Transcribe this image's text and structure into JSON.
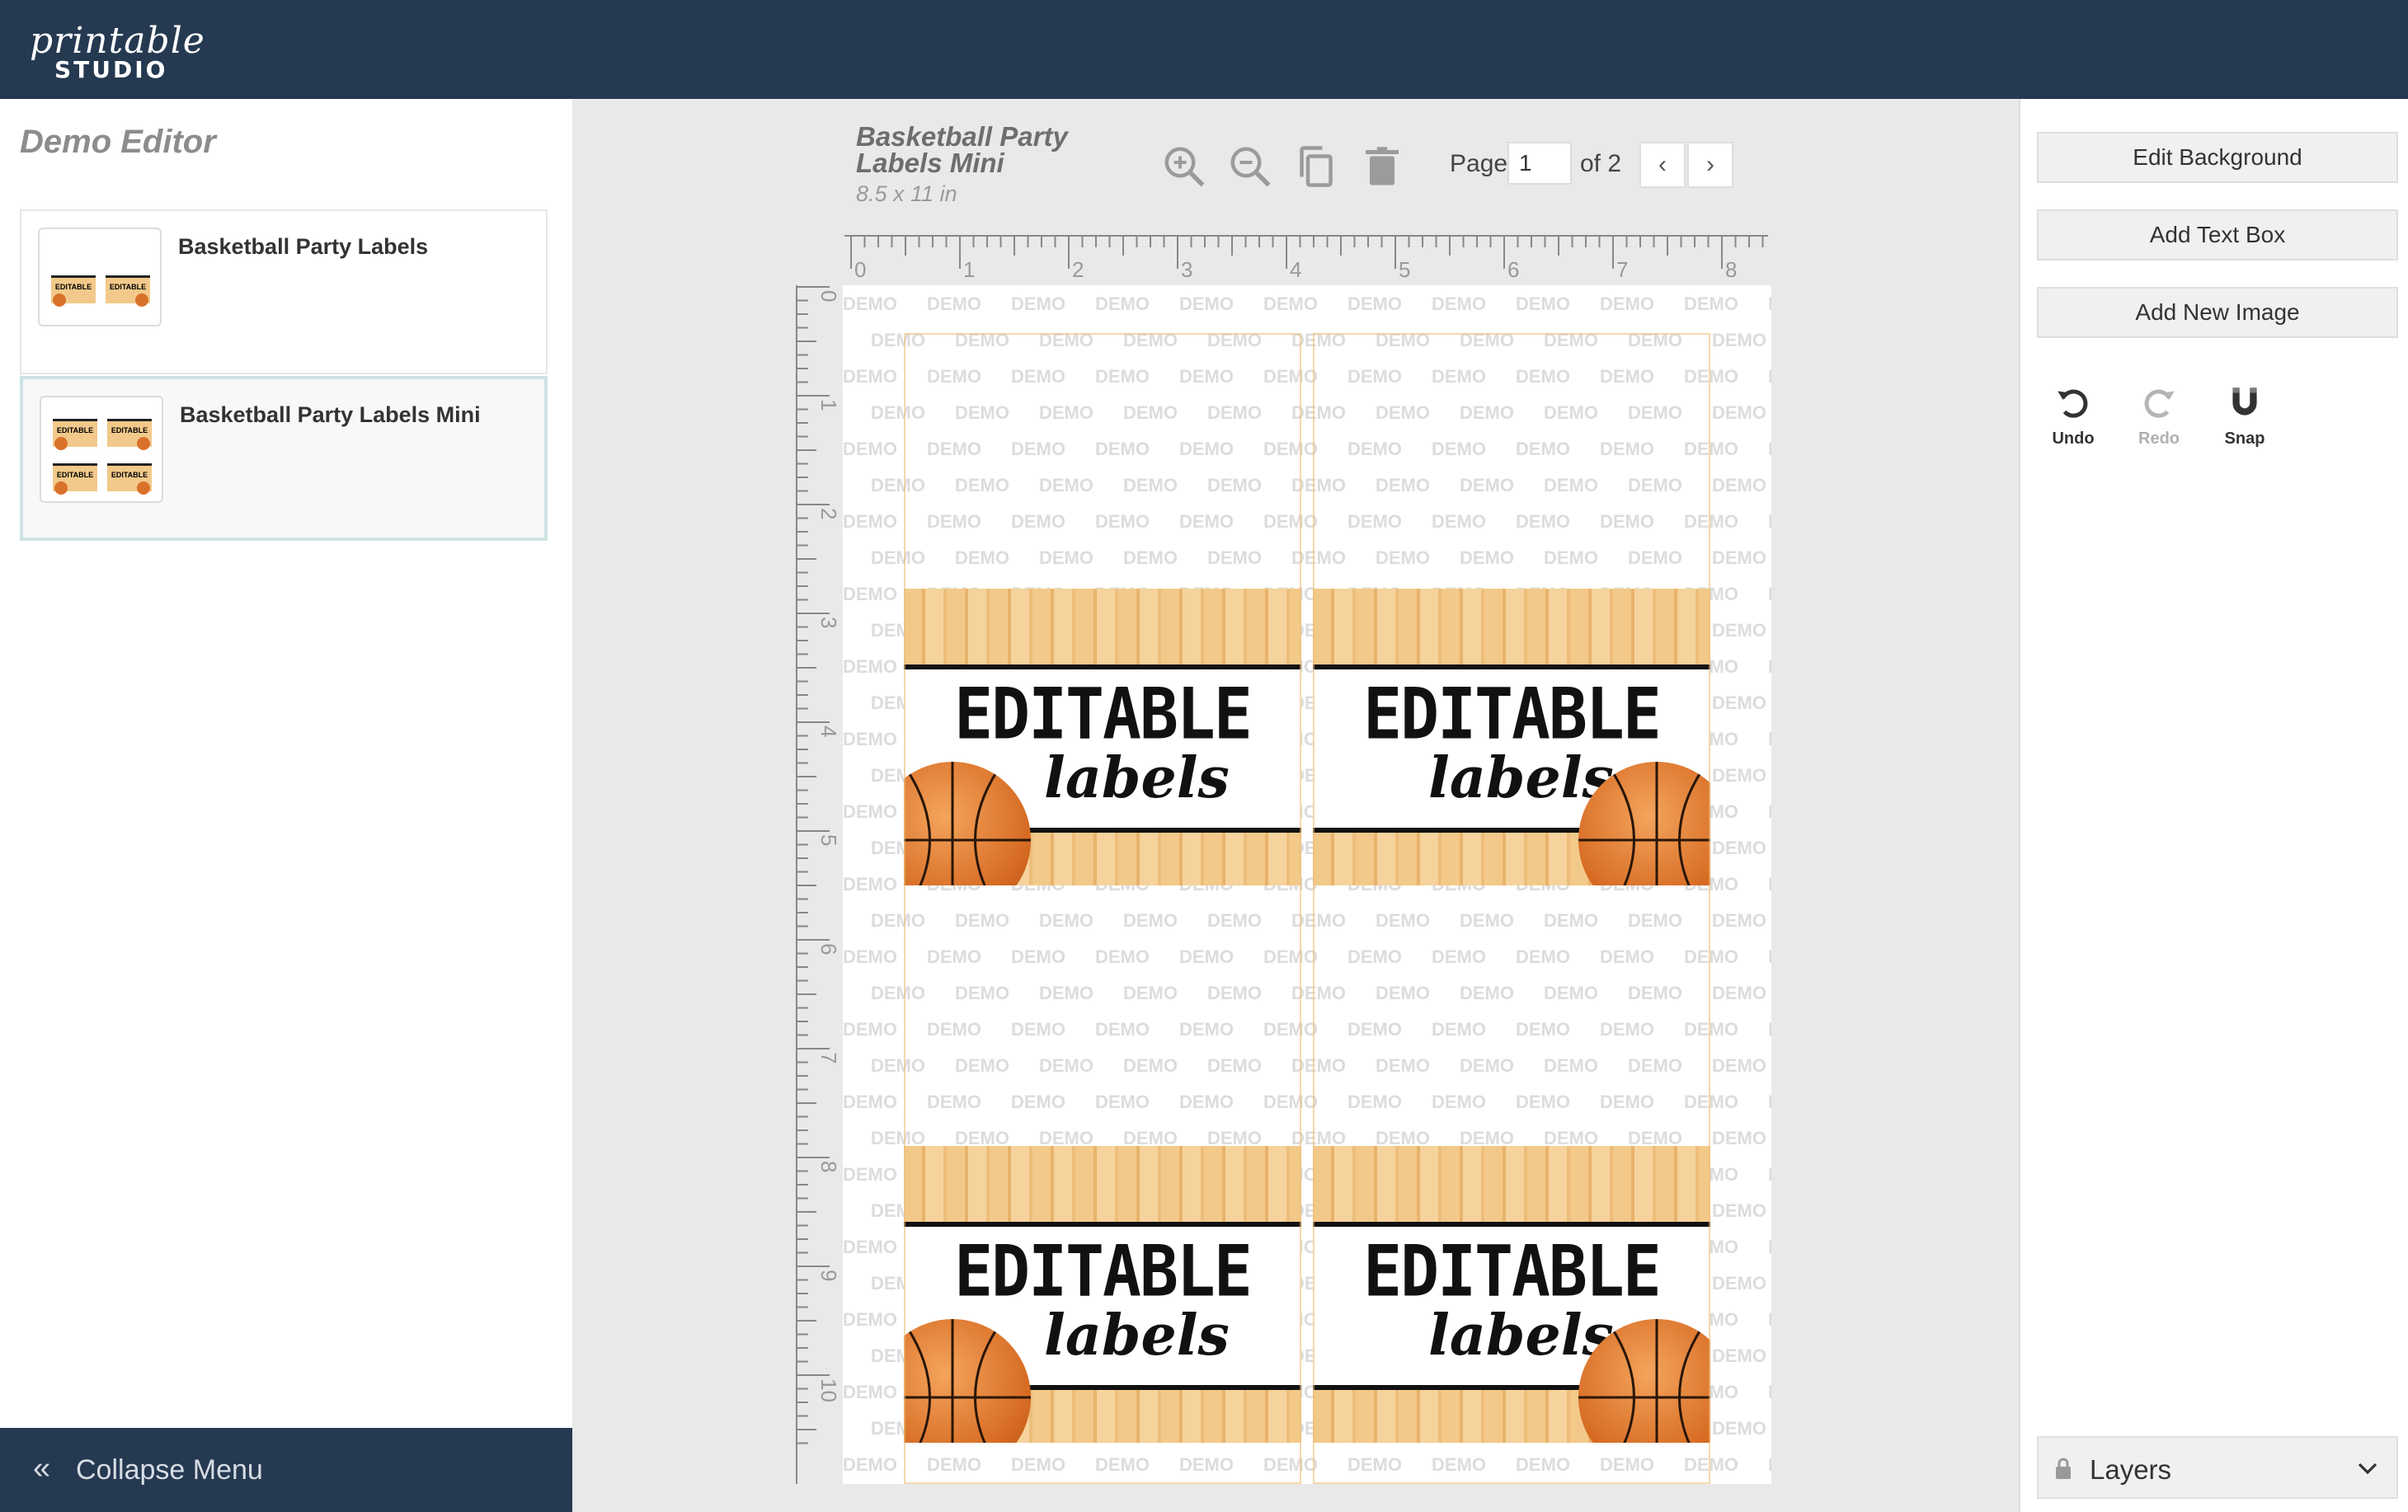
{
  "app": {
    "logo_script": "printable",
    "logo_word": "STUDIO"
  },
  "sidebar": {
    "title": "Demo Editor",
    "templates": [
      {
        "name": "Basketball Party Labels",
        "selected": false
      },
      {
        "name": "Basketball Party Labels Mini",
        "selected": true
      }
    ],
    "collapse_label": "Collapse Menu"
  },
  "document": {
    "title": "Basketball Party Labels Mini",
    "size": "8.5 x 11 in",
    "page_label": "Page",
    "page_value": "1",
    "page_of": "of 2"
  },
  "toolbar": {
    "icons": [
      "zoom-in-icon",
      "zoom-out-icon",
      "duplicate-icon",
      "trash-icon"
    ]
  },
  "rulers": {
    "horizontal": [
      "0",
      "1",
      "2",
      "3",
      "4",
      "5",
      "6",
      "7",
      "8"
    ],
    "vertical": [
      "0",
      "1",
      "2",
      "3",
      "4",
      "5",
      "6",
      "7",
      "8",
      "9",
      "10"
    ]
  },
  "canvas": {
    "watermark_text": "DEMO",
    "labels": [
      {
        "big": "EDITABLE",
        "script": "labels"
      },
      {
        "big": "EDITABLE",
        "script": "labels"
      },
      {
        "big": "EDITABLE",
        "script": "labels"
      },
      {
        "big": "EDITABLE",
        "script": "labels"
      }
    ]
  },
  "rightpanel": {
    "buttons": [
      "Edit Background",
      "Add Text Box",
      "Add New Image"
    ],
    "undo": "Undo",
    "redo": "Redo",
    "snap": "Snap",
    "layers": "Layers"
  },
  "colors": {
    "topbar": "#253951",
    "wood": "#f3c98a",
    "ball": "#d66a22"
  }
}
